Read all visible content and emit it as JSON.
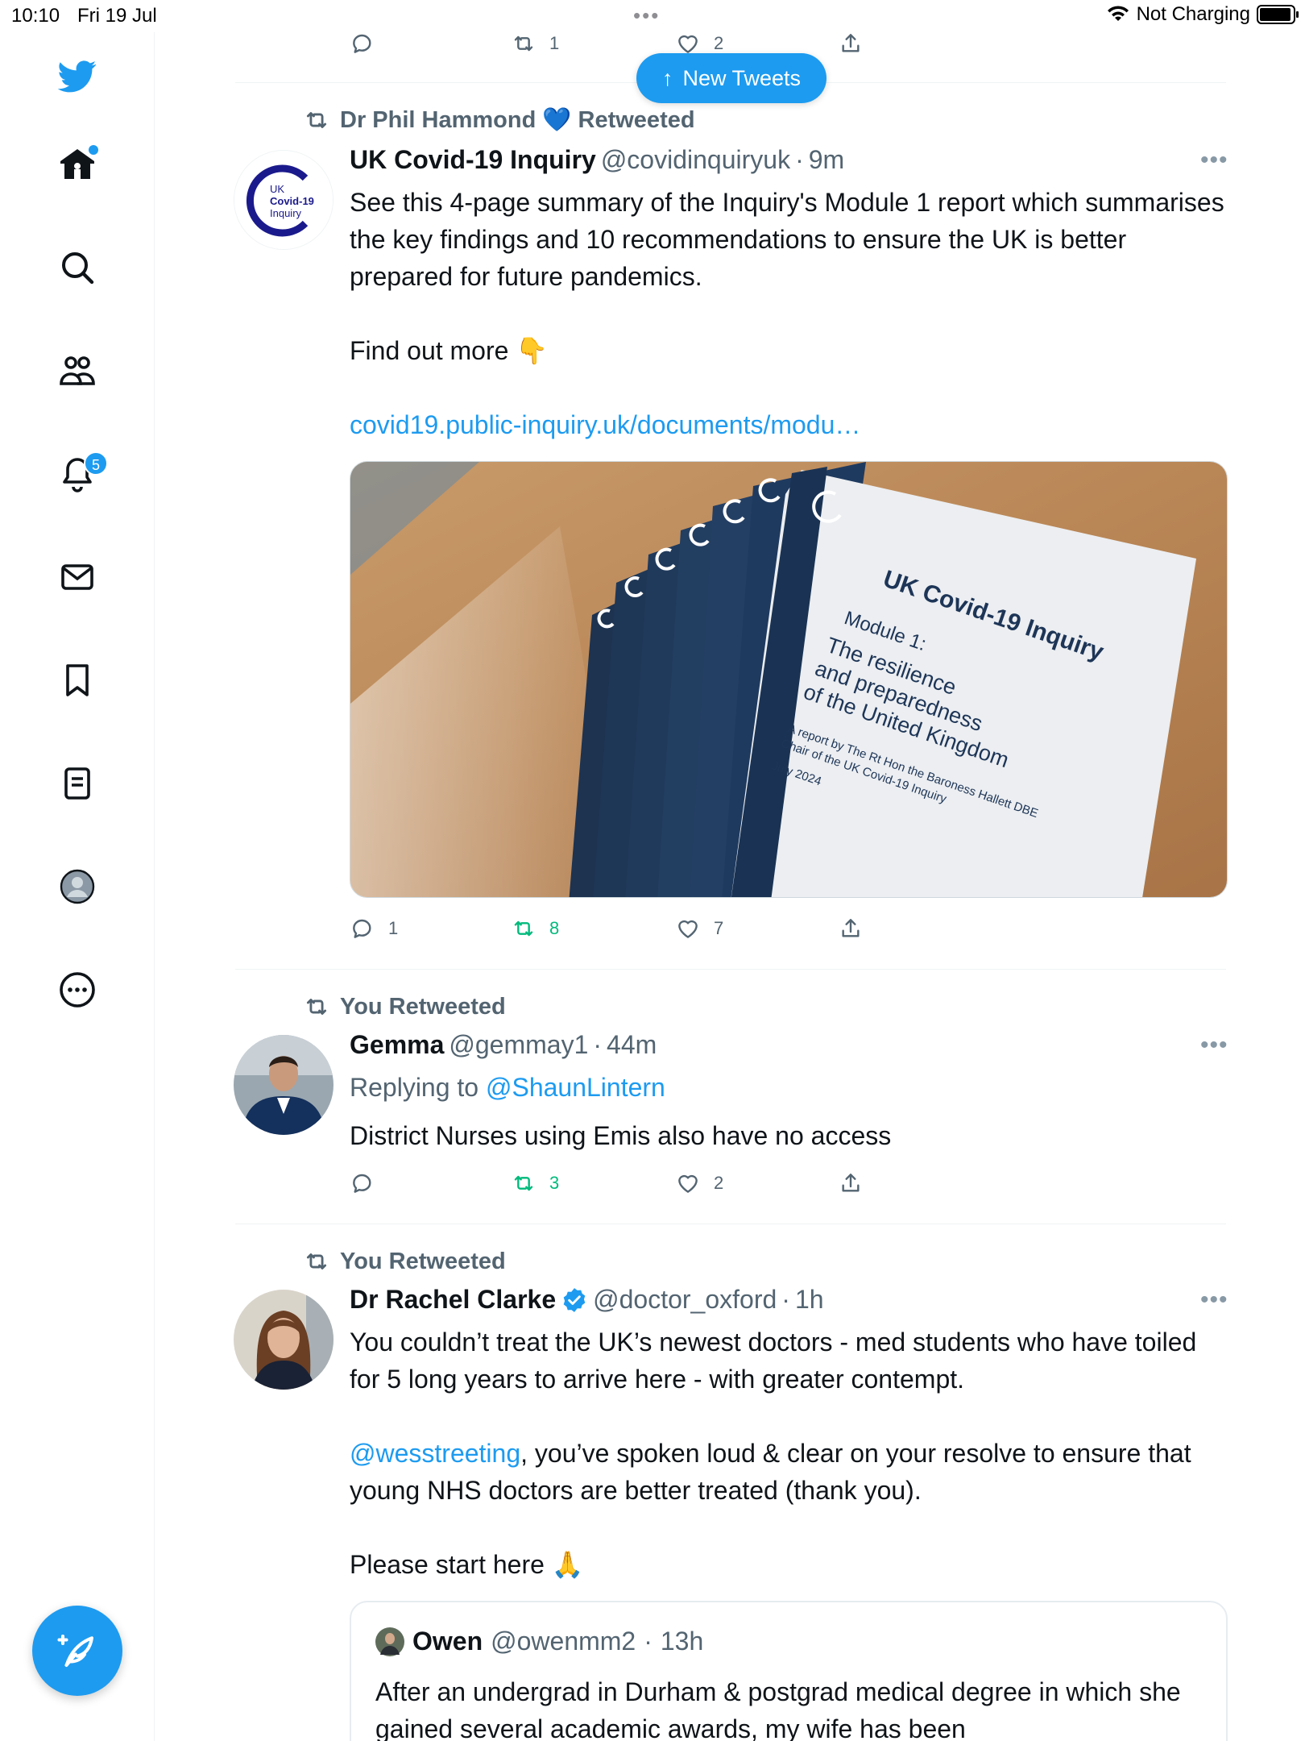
{
  "status_bar": {
    "time": "10:10",
    "date": "Fri 19 Jul",
    "charging": "Not Charging"
  },
  "colors": {
    "accent": "#1d9bf0",
    "retweet_green": "#00ba7c",
    "secondary_text": "#536471"
  },
  "sidebar": {
    "icons": [
      "twitter-logo-icon",
      "home-icon",
      "search-icon",
      "communities-icon",
      "notifications-icon",
      "messages-icon",
      "bookmarks-icon",
      "lists-icon",
      "profile-icon",
      "more-icon"
    ],
    "notification_count": "5",
    "compose_icon": "compose-tweet-icon"
  },
  "new_tweets_label": "New Tweets",
  "top_actions": {
    "retweets": "1",
    "likes": "2"
  },
  "tweets": [
    {
      "context": "Dr Phil Hammond 💙 Retweeted",
      "name": "UK Covid-19 Inquiry",
      "handle": "@covidinquiryuk",
      "time": "9m",
      "avatar_text": [
        "UK",
        "Covid-19",
        "Inquiry"
      ],
      "text_p1": "See this 4-page summary of the Inquiry's Module 1 report which summarises the key findings and 10 recommendations to ensure the UK is better prepared for future pandemics.",
      "text_p2": "Find out more 👇",
      "link": "covid19.public-inquiry.uk/documents/modu…",
      "image": {
        "title": "UK Covid-19 Inquiry",
        "module": "Module 1:",
        "subtitle_lines": [
          "The resilience",
          "and preparedness",
          "of the United Kingdom"
        ],
        "byline_lines": [
          "A report by The Rt Hon the Baroness Hallett DBE",
          "Chair of the UK Covid-19 Inquiry"
        ],
        "date": "July 2024"
      },
      "replies": "1",
      "retweets": "8",
      "likes": "7"
    },
    {
      "context": "You Retweeted",
      "name": "Gemma",
      "handle": "@gemmay1",
      "time": "44m",
      "replying_prefix": "Replying to ",
      "replying_to": "@ShaunLintern",
      "text": "District Nurses using Emis also have no access",
      "replies": "",
      "retweets": "3",
      "likes": "2"
    },
    {
      "context": "You Retweeted",
      "name": "Dr Rachel Clarke",
      "handle": "@doctor_oxford",
      "time": "1h",
      "text_p1": "You couldn’t treat the UK’s newest doctors - med students who have toiled for 5 long years to arrive here - with greater contempt.",
      "mention": "@wesstreeting",
      "text_p2_rest": ", you’ve spoken loud & clear on your resolve to ensure that young NHS doctors are better treated (thank you).",
      "text_p3": "Please start here 🙏",
      "quote": {
        "name": "Owen",
        "handle": "@owenmm2",
        "time": "13h",
        "text": "After an undergrad in Durham & postgrad medical degree in which she gained several academic awards, my wife has been"
      }
    }
  ]
}
